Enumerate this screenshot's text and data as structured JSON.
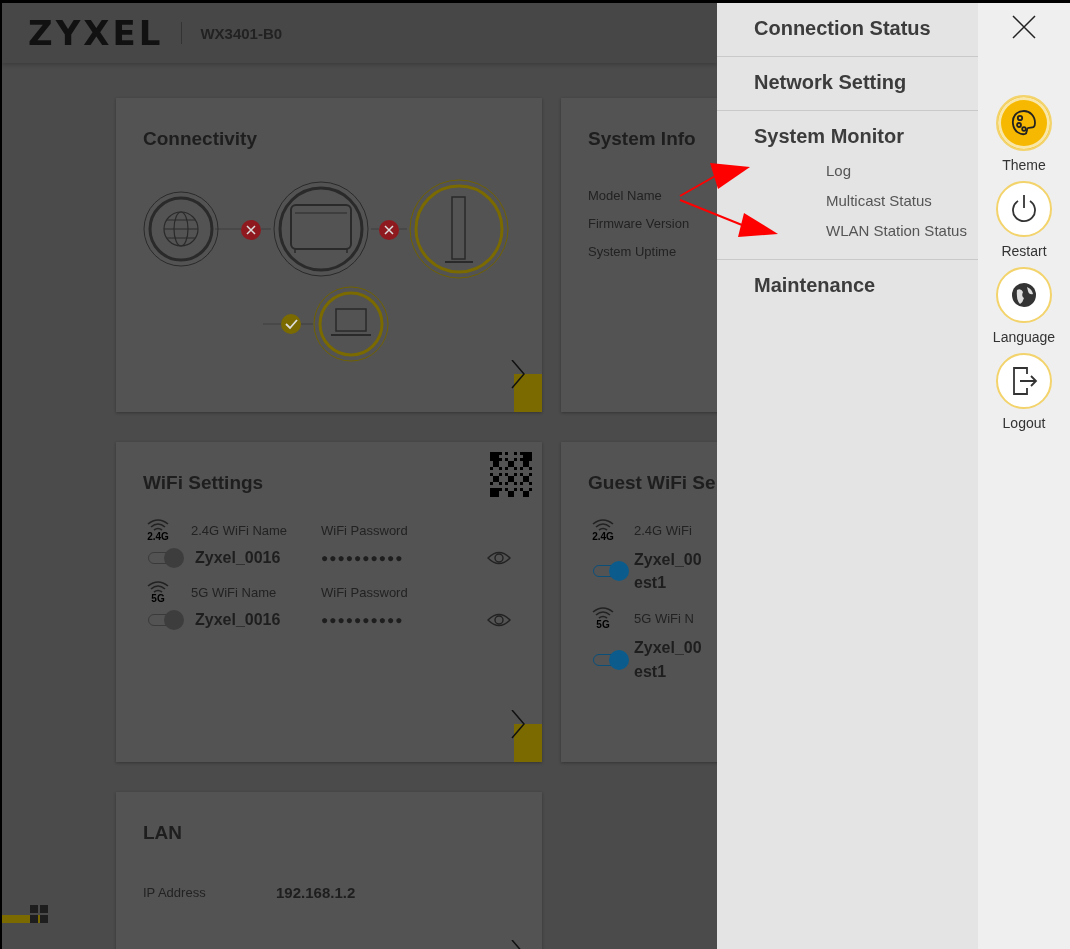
{
  "header": {
    "logo": "ZYXEL",
    "model": "WX3401-B0"
  },
  "connectivity": {
    "title": "Connectivity"
  },
  "system_info": {
    "title": "System Info",
    "rows": [
      "Model Name",
      "Firmware Version",
      "System Uptime"
    ]
  },
  "wifi_settings": {
    "title": "WiFi Settings",
    "networks": [
      {
        "band": "2.4G",
        "name_label": "2.4G WiFi Name",
        "password_label": "WiFi Password",
        "name": "Zyxel_0016",
        "password": "●●●●●●●●●●",
        "on": false
      },
      {
        "band": "5G",
        "name_label": "5G WiFi Name",
        "password_label": "WiFi Password",
        "name": "Zyxel_0016",
        "password": "●●●●●●●●●●",
        "on": false
      }
    ]
  },
  "guest_wifi": {
    "title": "Guest WiFi Se",
    "networks": [
      {
        "band": "2.4G",
        "name_label": "2.4G WiFi",
        "name": "Zyxel_00",
        "name_line2": "est1",
        "on": true
      },
      {
        "band": "5G",
        "name_label": "5G WiFi N",
        "name": "Zyxel_00",
        "name_line2": "est1",
        "on": true
      }
    ]
  },
  "lan": {
    "title": "LAN",
    "rows": [
      {
        "label": "IP Address",
        "value": "192.168.1.2"
      }
    ]
  },
  "menu": {
    "items": [
      {
        "label": "Connection Status"
      },
      {
        "label": "Network Setting"
      },
      {
        "label": "System Monitor",
        "children": [
          "Log",
          "Multicast Status",
          "WLAN Station Status"
        ]
      },
      {
        "label": "Maintenance"
      }
    ]
  },
  "rail": {
    "buttons": [
      {
        "kind": "theme",
        "label": "Theme",
        "selected": true
      },
      {
        "kind": "restart",
        "label": "Restart",
        "selected": false
      },
      {
        "kind": "language",
        "label": "Language",
        "selected": false
      },
      {
        "kind": "logout",
        "label": "Logout",
        "selected": false
      }
    ]
  }
}
